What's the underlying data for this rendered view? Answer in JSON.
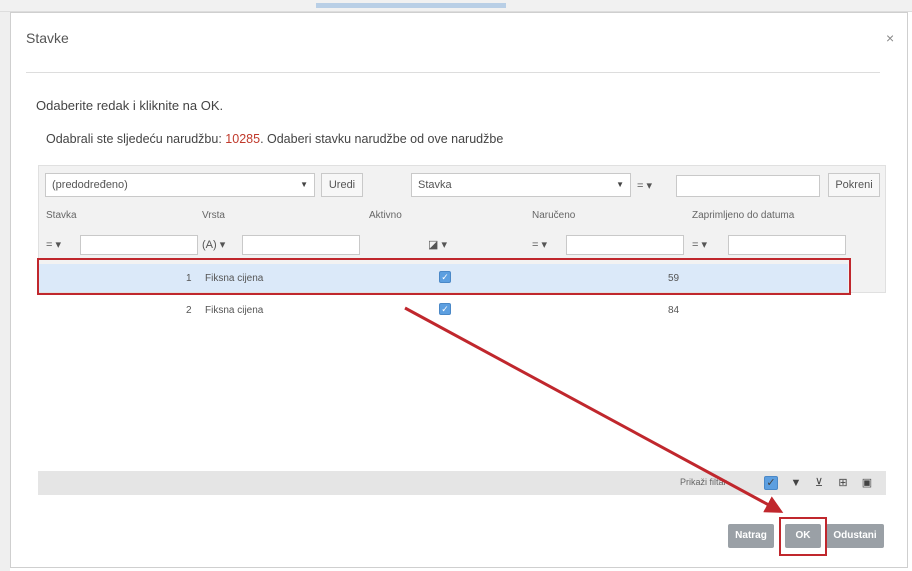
{
  "dialog": {
    "title": "Stavke",
    "close_glyph": "×",
    "instruction": "Odaberite redak i kliknite na OK.",
    "chosen_prefix": "Odabrali ste sljedeću narudžbu:",
    "order_number": "10285",
    "chosen_suffix": ". Odaberi stavku narudžbe od ove narudžbe"
  },
  "toolbar": {
    "view_select": "(predodređeno)",
    "edit_label": "Uredi",
    "field_select": "Stavka",
    "operator": "=",
    "search_value": "",
    "run_label": "Pokreni"
  },
  "columns": [
    {
      "label": "Stavka",
      "filter_op": "="
    },
    {
      "label": "Vrsta",
      "filter_op": "(A)"
    },
    {
      "label": "Aktivno",
      "filter_op": ""
    },
    {
      "label": "Naručeno",
      "filter_op": "="
    },
    {
      "label": "Zaprimljeno do datuma",
      "filter_op": "="
    }
  ],
  "rows": [
    {
      "stavka": "1",
      "vrsta": "Fiksna cijena",
      "aktivno": true,
      "naruceno": "59",
      "zaprimljeno": ""
    },
    {
      "stavka": "2",
      "vrsta": "Fiksna cijena",
      "aktivno": true,
      "naruceno": "84",
      "zaprimljeno": ""
    }
  ],
  "footer": {
    "show_filter_label": "Prikaži filtar",
    "icons": [
      "checkbox-icon",
      "filter-icon",
      "clear-filter-icon",
      "export-icon",
      "settings-icon"
    ]
  },
  "actions": {
    "back_label": "Natrag",
    "ok_label": "OK",
    "cancel_label": "Odustani"
  },
  "colors": {
    "highlight": "#c0272d",
    "selected_row": "#dbe9f9",
    "checkbox": "#5d9fe0",
    "order_number": "#c0392b",
    "action_button": "#9aa0a6"
  }
}
